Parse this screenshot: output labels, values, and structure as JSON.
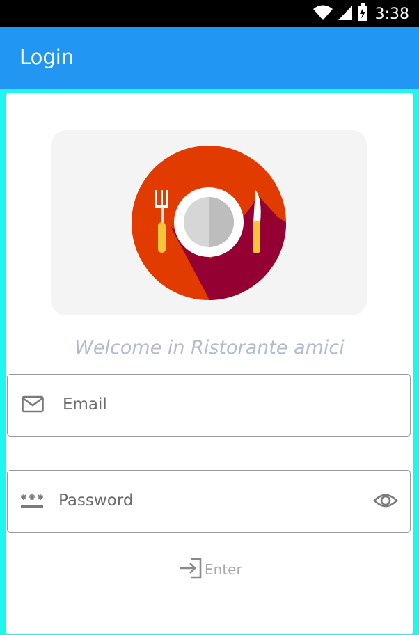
{
  "status_bar": {
    "time": "3:38",
    "icons": [
      "wifi-icon",
      "cell-signal-icon",
      "battery-charging-icon"
    ]
  },
  "app_bar": {
    "title": "Login"
  },
  "logo": {
    "icon": "plate-cutlery-logo"
  },
  "welcome_text": "Welcome in Ristorante amici",
  "form": {
    "email": {
      "placeholder": "Email",
      "value": "",
      "icon": "mail-icon"
    },
    "password": {
      "placeholder": "Password",
      "value": "",
      "icon": "password-icon",
      "toggle_icon": "eye-icon"
    },
    "enter": {
      "label": "Enter",
      "icon": "login-arrow-icon"
    }
  },
  "colors": {
    "app_bar": "#2196f3",
    "frame": "#1ef7ec",
    "welcome": "#b3bccd",
    "logo_bg": "#f4f4f4",
    "plate_circle": "#e13b00",
    "plate_shadow": "#940032"
  }
}
